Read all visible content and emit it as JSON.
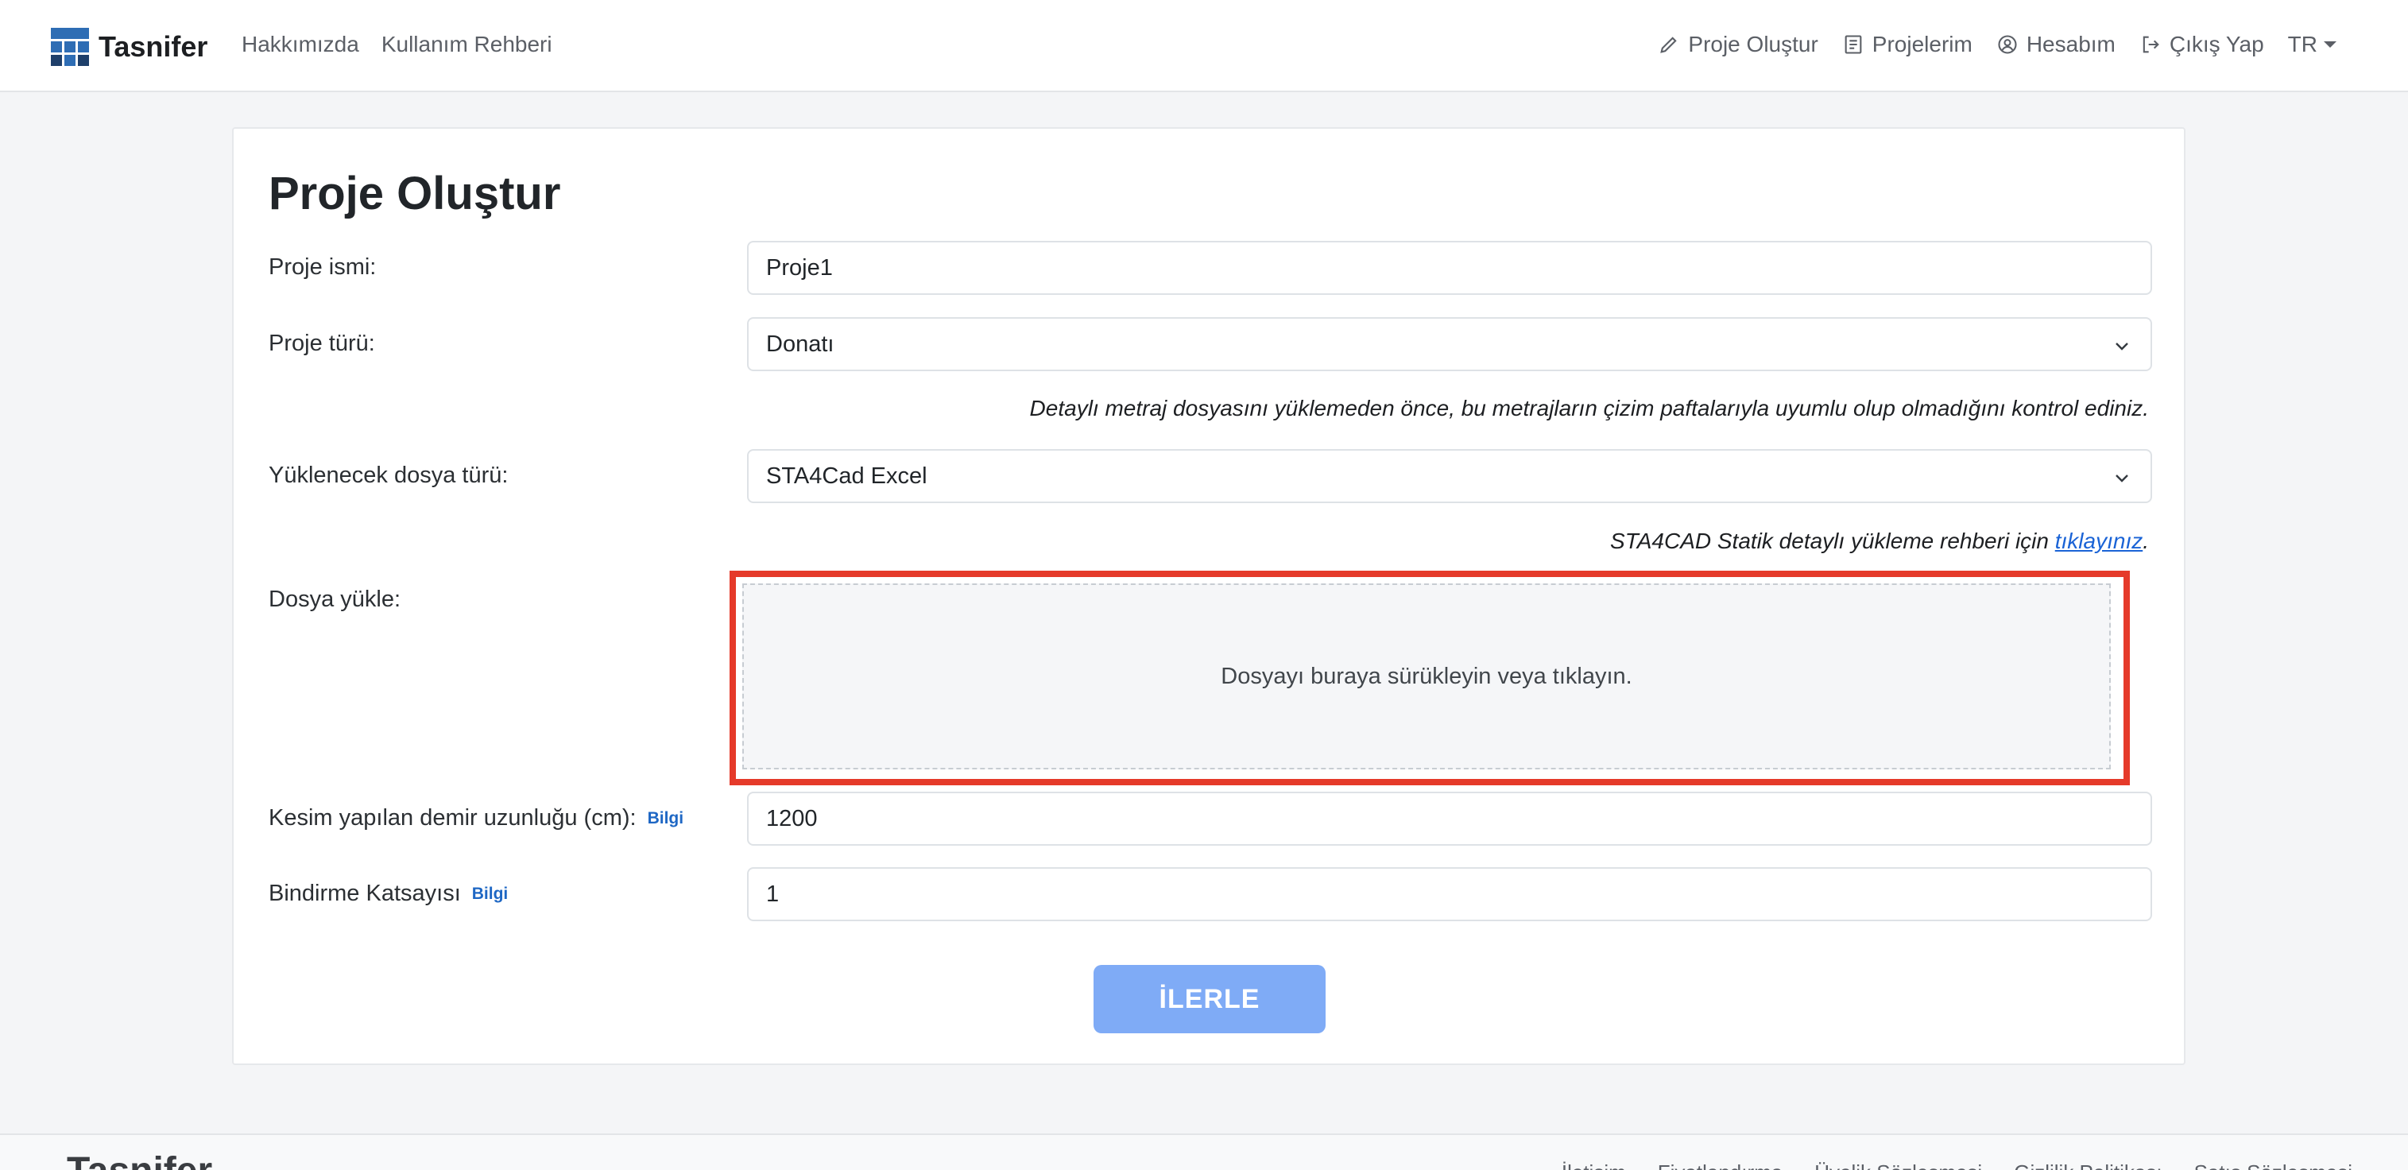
{
  "navbar": {
    "brand": "Tasnifer",
    "left_links": [
      "Hakkımızda",
      "Kullanım Rehberi"
    ],
    "right_links": [
      {
        "label": "Proje Oluştur",
        "icon": "pencil-icon"
      },
      {
        "label": "Projelerim",
        "icon": "document-list-icon"
      },
      {
        "label": "Hesabım",
        "icon": "user-circle-icon"
      },
      {
        "label": "Çıkış Yap",
        "icon": "logout-icon"
      }
    ],
    "language": "TR"
  },
  "form": {
    "title": "Proje Oluştur",
    "project_name_label": "Proje ismi:",
    "project_name_value": "Proje1",
    "project_type_label": "Proje türü:",
    "project_type_value": "Donatı",
    "project_type_hint": "Detaylı metraj dosyasını yüklemeden önce, bu metrajların çizim paftalarıyla uyumlu olup olmadığını kontrol ediniz.",
    "file_type_label": "Yüklenecek dosya türü:",
    "file_type_value": "STA4Cad Excel",
    "guide_hint_prefix": "STA4CAD Statik detaylı yükleme rehberi için ",
    "guide_hint_link": "tıklayınız",
    "guide_hint_suffix": ".",
    "upload_label": "Dosya yükle:",
    "dropzone_text": "Dosyayı buraya sürükleyin veya tıklayın.",
    "cut_length_label": "Kesim yapılan demir uzunluğu (cm):",
    "cut_length_info": "Bilgi",
    "cut_length_value": "1200",
    "overlap_label": "Bindirme Katsayısı",
    "overlap_info": "Bilgi",
    "overlap_value": "1",
    "submit_label": "İLERLE"
  },
  "footer": {
    "brand": "Tasnifer",
    "links": [
      "İletişim",
      "Fiyatlandırma",
      "Üyelik Sözleşmesi",
      "Gizlilik Politikası",
      "Satış Sözleşmesi"
    ]
  },
  "colors": {
    "accent": "#1e67c4",
    "button": "#7fabf6",
    "highlight": "#e53a2a"
  }
}
